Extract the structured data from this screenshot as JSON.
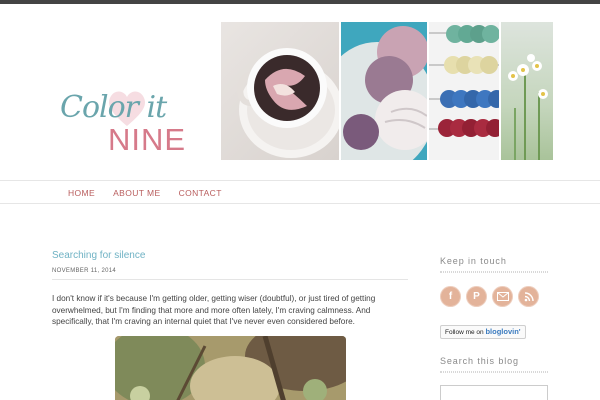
{
  "header": {
    "logo_line1": "Color it",
    "logo_line2": "NINE"
  },
  "nav": {
    "items": [
      "HOME",
      "ABOUT ME",
      "CONTACT"
    ]
  },
  "post": {
    "title": "Searching for silence",
    "date": "NOVEMBER 11, 2014",
    "body": "I don't know if it's because I'm getting older, getting wiser (doubtful), or just tired of getting overwhelmed, but I'm finding that more and more often lately,  I'm craving calmness.  And specifically, that I'm craving an internal quiet that I've never even considered before."
  },
  "sidebar": {
    "keep_in_touch": "Keep in touch",
    "social_icons": [
      "facebook-icon",
      "pinterest-icon",
      "email-icon",
      "rss-icon"
    ],
    "bloglovin_prefix": "Follow me on",
    "bloglovin_brand": "bloglovin'",
    "search_heading": "Search this blog"
  },
  "colors": {
    "logo_teal": "#6aa5ac",
    "logo_pink": "#d67a8a",
    "nav_link": "#b85c5c",
    "post_title": "#6fb2c4",
    "social_bg": "#e3b39a"
  }
}
